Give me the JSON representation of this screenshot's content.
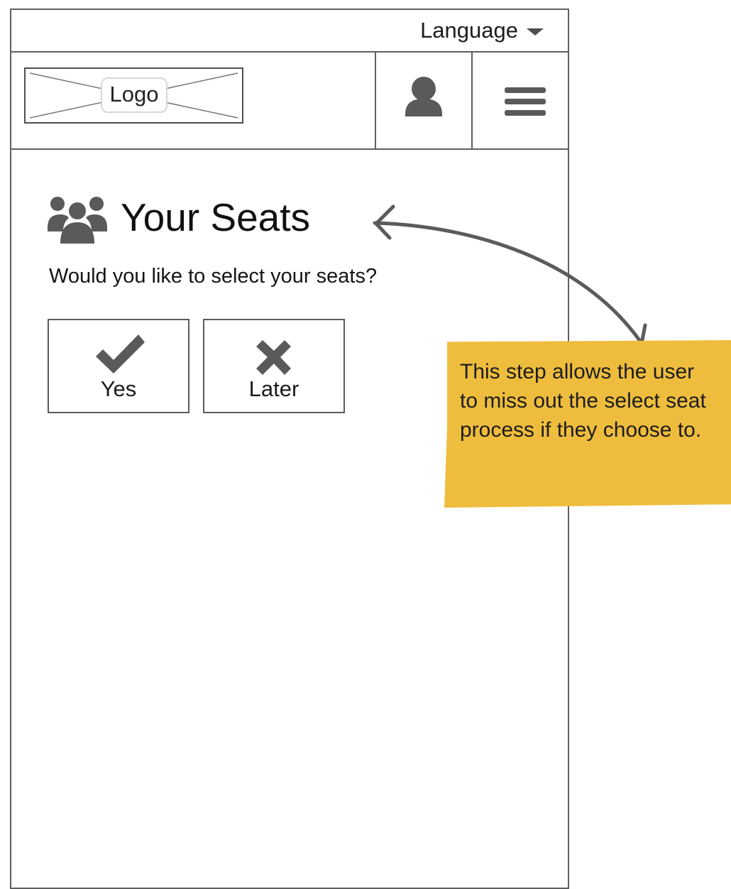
{
  "language_bar": {
    "label": "Language"
  },
  "header": {
    "logo_label": "Logo"
  },
  "content": {
    "title": "Your Seats",
    "question": "Would you like to select your seats?",
    "buttons": [
      {
        "label": "Yes",
        "icon": "check-icon"
      },
      {
        "label": "Later",
        "icon": "close-icon"
      }
    ]
  },
  "annotation": {
    "text": "This step allows the user to miss out the select seat process if they choose to."
  },
  "icons": {
    "title_icon": "users-icon",
    "profile_icon": "user-icon",
    "menu_icon": "hamburger-menu-icon",
    "language_icon": "caret-down-icon"
  },
  "colors": {
    "sticky_note": "#efbd3d",
    "icon_gray": "#5a5a5a",
    "border_gray": "#5f5f5f"
  }
}
